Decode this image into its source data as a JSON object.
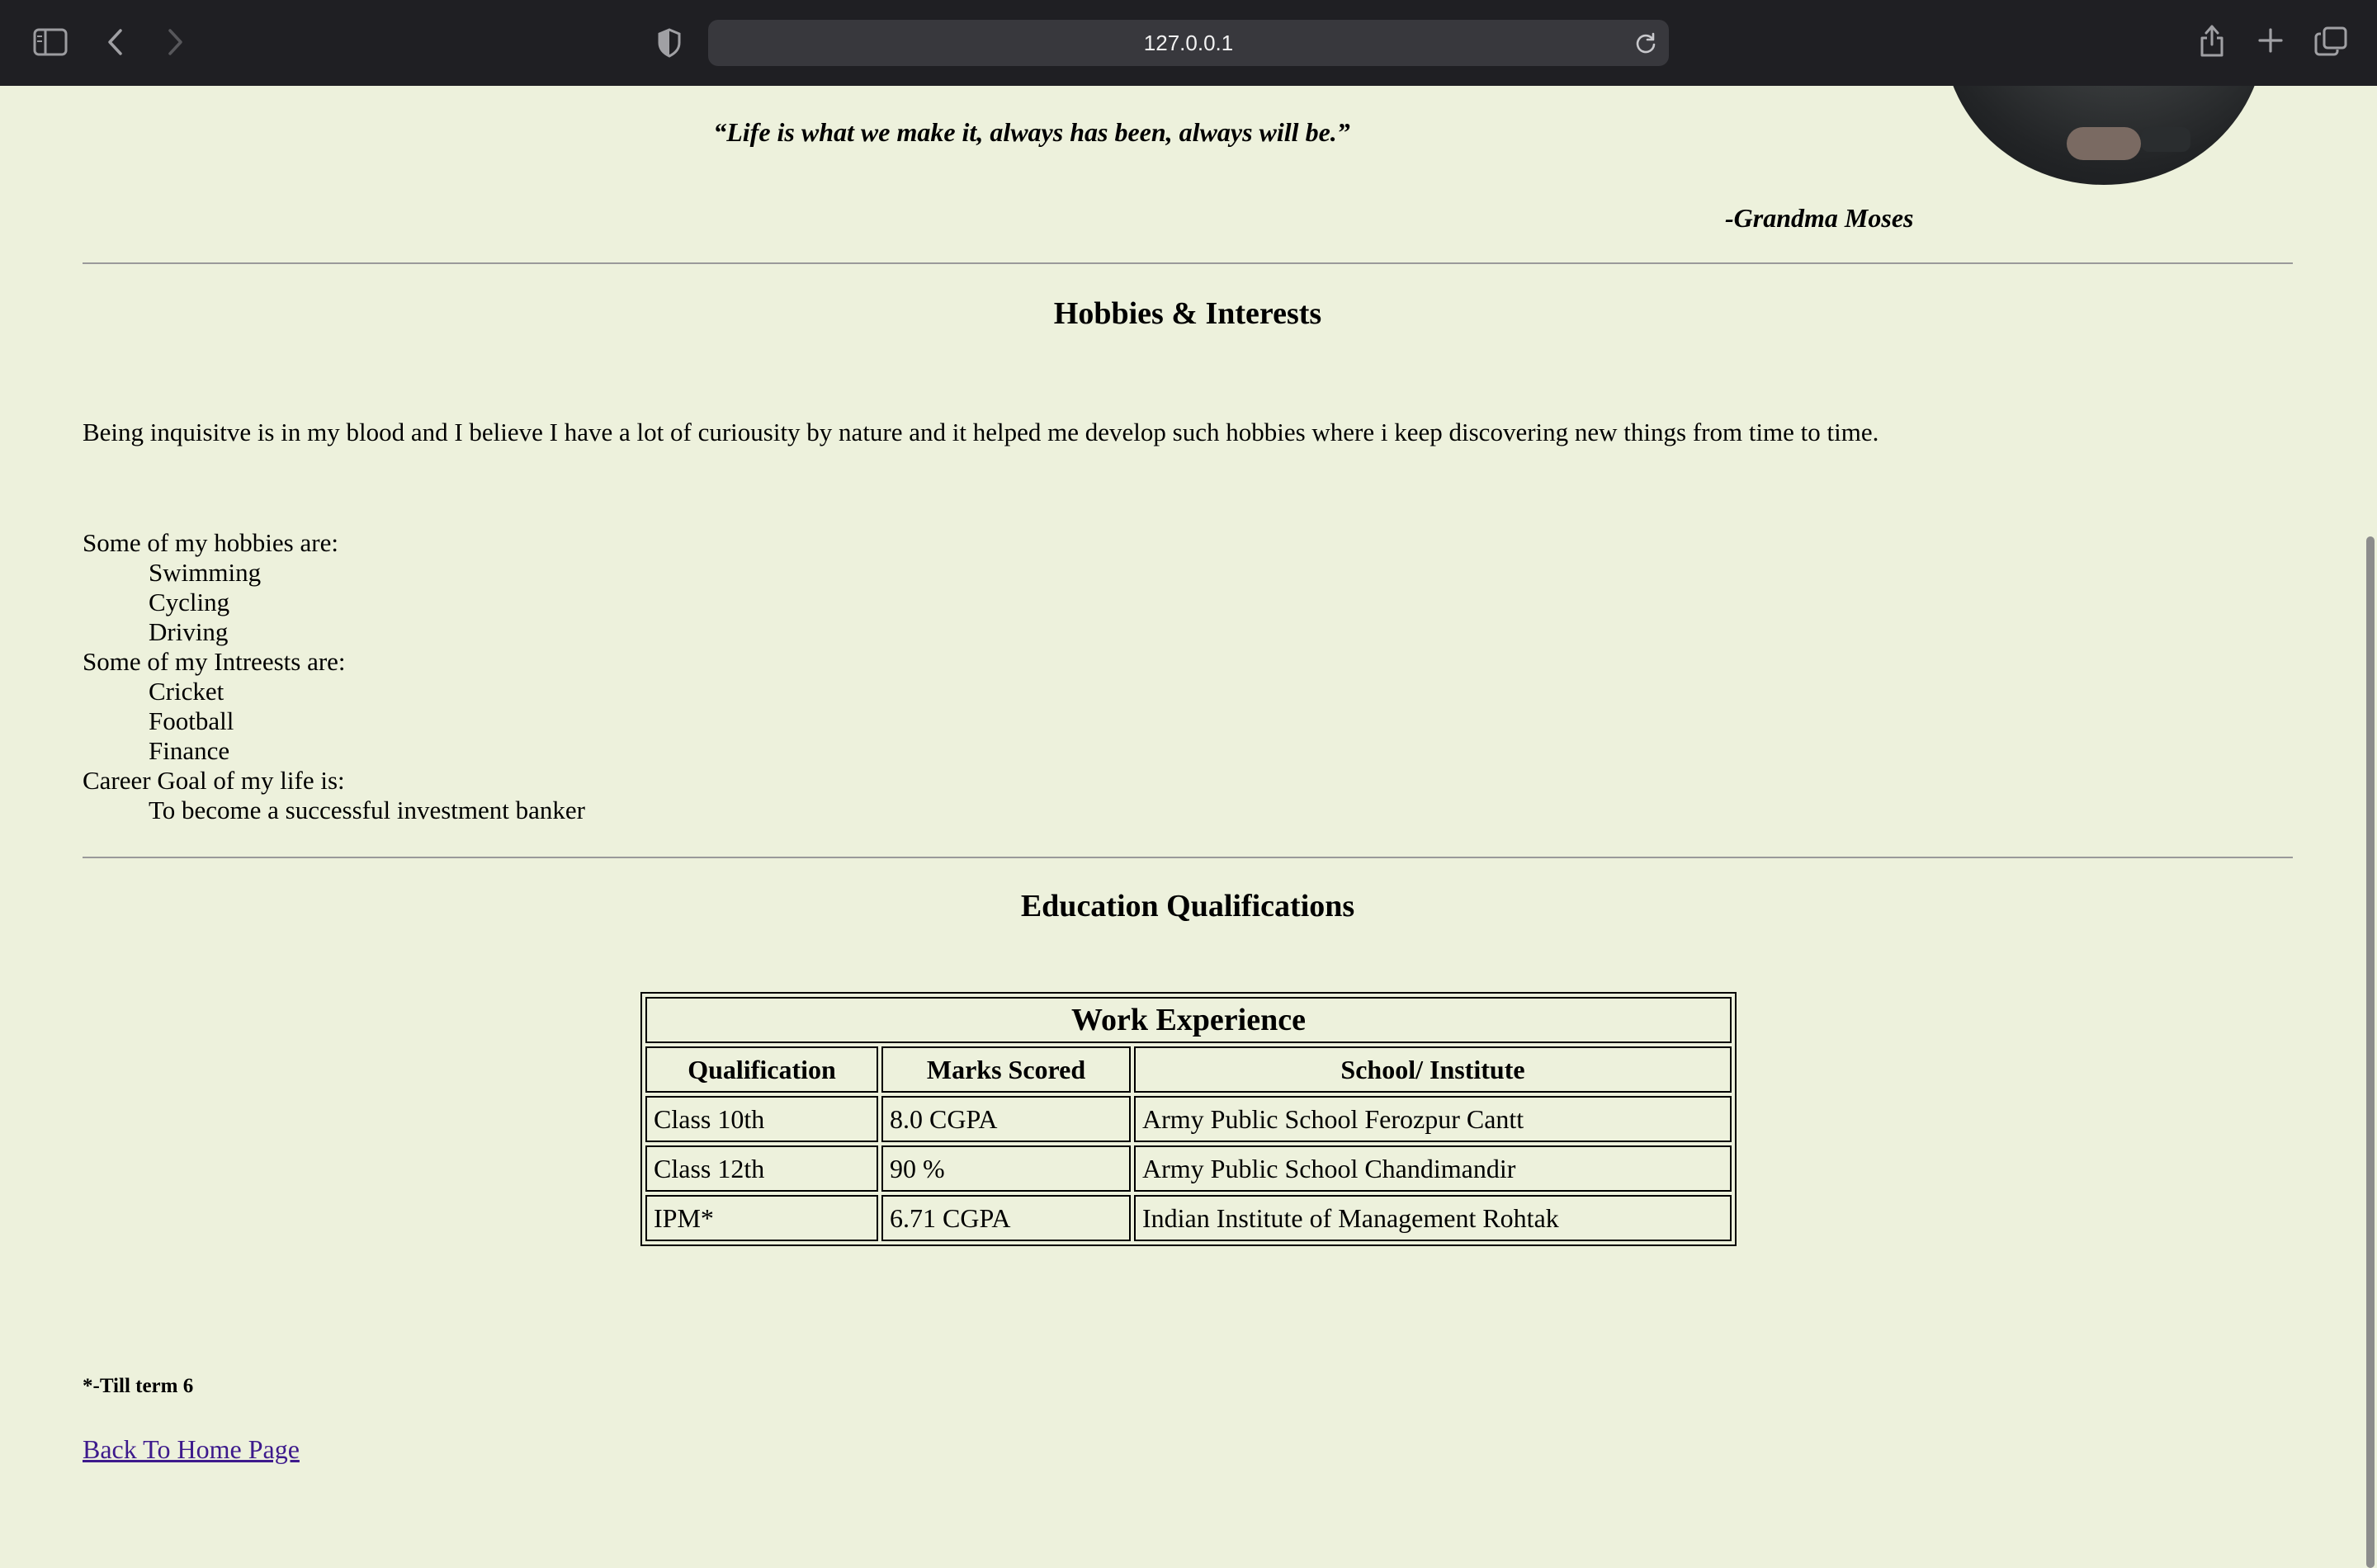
{
  "browser": {
    "url": "127.0.0.1",
    "icons": [
      "sidebar-icon",
      "back-icon",
      "forward-icon",
      "shield-icon",
      "reload-icon",
      "share-icon",
      "new-tab-icon",
      "tabs-overview-icon"
    ]
  },
  "quote": {
    "text": "“Life is what we make it, always has been, always will be.”",
    "author": "-Grandma Moses"
  },
  "hobbies": {
    "heading": "Hobbies & Interests",
    "intro": "Being inquisitve is in my blood and I believe I have a lot of curiousity by nature and it helped me develop such hobbies where i keep discovering new things from time to time.",
    "hobbies_label": "Some of my hobbies are:",
    "hobbies_list": [
      "Swimming",
      "Cycling",
      "Driving"
    ],
    "interests_label": "Some of my Intreests are:",
    "interests_list": [
      "Cricket",
      "Football",
      "Finance"
    ],
    "career_label": "Career Goal of my life is:",
    "career_goal": "To become a successful investment banker"
  },
  "education": {
    "heading": "Education Qualifications",
    "table_caption": "Work Experience",
    "columns": [
      "Qualification",
      "Marks Scored",
      "School/ Institute"
    ],
    "rows": [
      [
        "Class 10th",
        "8.0 CGPA",
        "Army Public School Ferozpur Cantt"
      ],
      [
        "Class 12th",
        "90 %",
        "Army Public School Chandimandir"
      ],
      [
        "IPM*",
        "6.71 CGPA",
        "Indian Institute of Management Rohtak"
      ]
    ],
    "footnote": "*-Till term 6"
  },
  "nav": {
    "back_link": "Back To Home Page"
  }
}
